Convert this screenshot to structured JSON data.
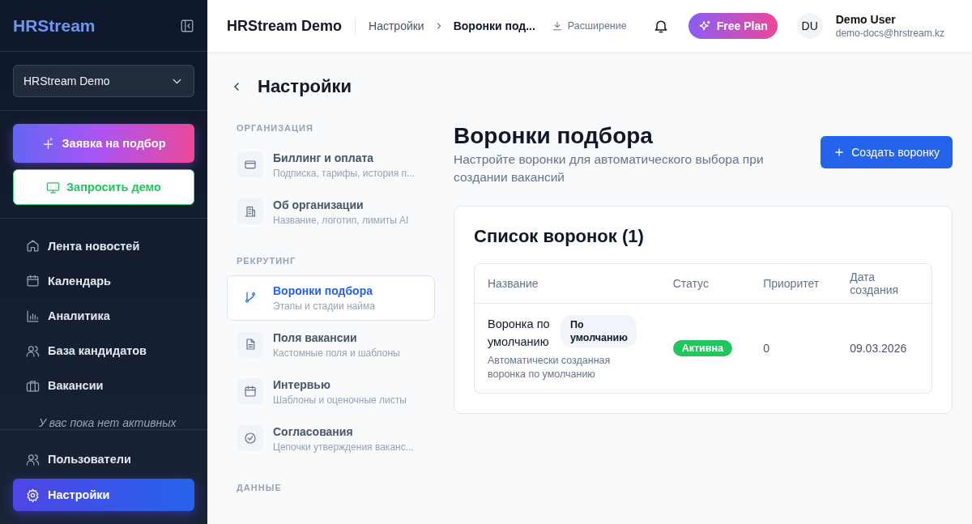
{
  "sidebar": {
    "logo": "HRStream",
    "workspace_select": {
      "value": "HRStream Demo"
    },
    "actions": [
      {
        "kind": "primary",
        "label": "Заявка на подбор"
      },
      {
        "kind": "outline",
        "label": "Запросить демо"
      }
    ],
    "nav_items": [
      {
        "kind": "home",
        "label": "Лента новостей",
        "selected": false
      },
      {
        "kind": "calendar",
        "label": "Календарь",
        "selected": false
      },
      {
        "kind": "chart",
        "label": "Аналитика",
        "selected": false
      },
      {
        "kind": "users",
        "label": "База кандидатов",
        "selected": false
      },
      {
        "kind": "briefcase",
        "label": "Вакансии",
        "selected": false
      }
    ],
    "empty_note": "У вас пока нет активных",
    "bottom_items": [
      {
        "kind": "users",
        "label": "Пользователи",
        "selected": false
      },
      {
        "kind": "gear",
        "label": "Настройки",
        "selected": true
      }
    ]
  },
  "header": {
    "title": "HRStream Demo",
    "breadcrumbs": [
      "Настройки",
      "Воронки под..."
    ],
    "extension_link": "Расширение",
    "plan_button": "Free Plan",
    "user": {
      "initials": "DU",
      "name": "Demo User",
      "email": "demo-docs@hrstream.kz"
    }
  },
  "page_title": "Настройки",
  "settings_nav": [
    {
      "title": "ОРГАНИЗАЦИЯ",
      "items": [
        {
          "kind": "card",
          "title": "Биллинг и оплата",
          "subtitle": "Подписка, тарифы, история п...",
          "selected": false
        },
        {
          "kind": "building",
          "title": "Об организации",
          "subtitle": "Название, логотип, лимиты AI",
          "selected": false
        }
      ]
    },
    {
      "title": "РЕКРУТИНГ",
      "items": [
        {
          "kind": "branch",
          "title": "Воронки подбора",
          "subtitle": "Этапы и стадии найма",
          "selected": true
        },
        {
          "kind": "doc",
          "title": "Поля вакансии",
          "subtitle": "Кастомные поля и шаблоны",
          "selected": false
        },
        {
          "kind": "calendar",
          "title": "Интервью",
          "subtitle": "Шаблоны и оценочные листы",
          "selected": false
        },
        {
          "kind": "check",
          "title": "Согласования",
          "subtitle": "Цепочки утверждения ваканс...",
          "selected": false
        }
      ]
    },
    {
      "title": "ДАННЫЕ"
    }
  ],
  "content": {
    "title": "Воронки подбора",
    "description": "Настройте воронки для автоматического выбора при создании вакансий",
    "create_button": "Создать воронку",
    "card_title": "Список воронок (1)",
    "table": {
      "columns": [
        "Название",
        "Статус",
        "Приоритет",
        "Дата создания"
      ],
      "rows": [
        {
          "name": "Воронка по умолчанию",
          "tag": "По умолчанию",
          "description": "Автоматически созданная воронка по умолчанию",
          "status": {
            "kind": "active",
            "label": "Активна"
          },
          "priority": "0",
          "created": "09.03.2026"
        }
      ]
    }
  }
}
